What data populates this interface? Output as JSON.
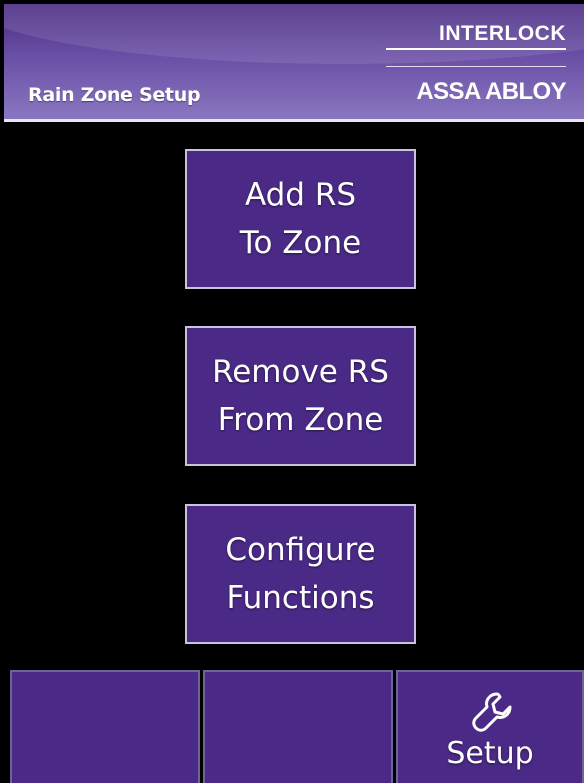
{
  "header": {
    "title": "Rain Zone Setup",
    "logo_top": "INTERLOCK",
    "logo_bottom": "ASSA ABLOY"
  },
  "menu": {
    "buttons": [
      {
        "line1": "Add RS",
        "line2": "To Zone"
      },
      {
        "line1": "Remove RS",
        "line2": "From Zone"
      },
      {
        "line1": "Configure",
        "line2": "Functions"
      }
    ]
  },
  "bottom_bar": {
    "setup_label": "Setup",
    "setup_icon": "wrench-icon"
  },
  "colors": {
    "background": "#000000",
    "button_fill": "#4a2a86",
    "button_border": "#c9c4dc",
    "header_gradient_top": "#4a2c83",
    "header_gradient_bottom": "#8b78c1",
    "text": "#ffffff"
  }
}
